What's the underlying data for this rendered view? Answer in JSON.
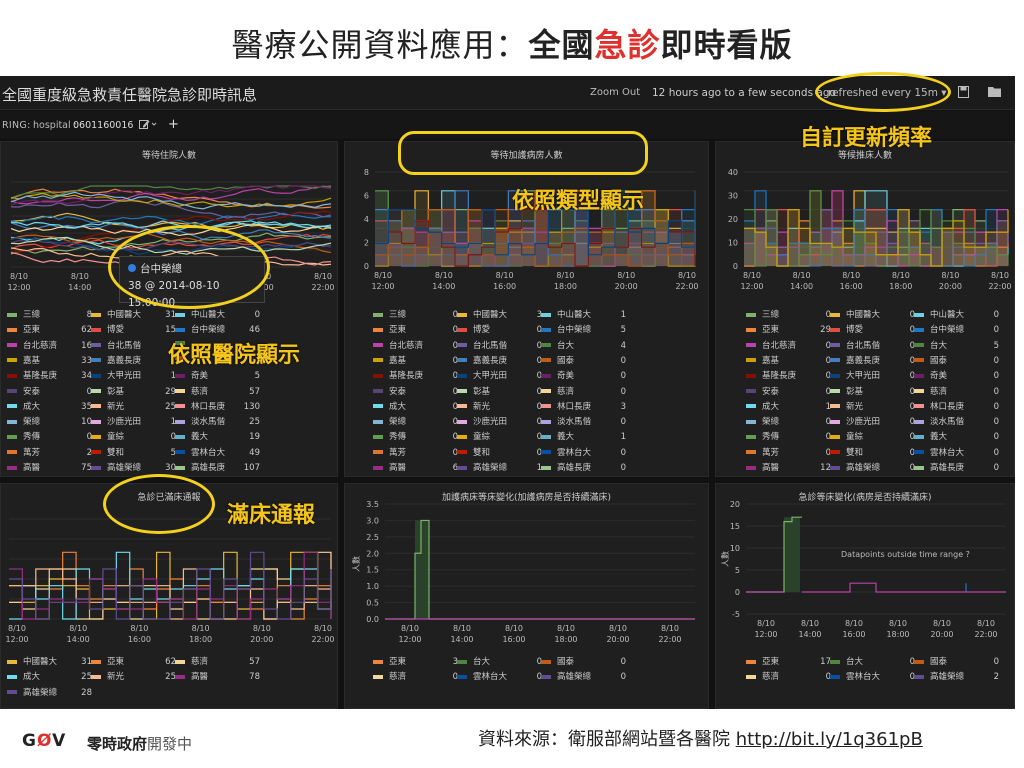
{
  "slide": {
    "title_prefix": "醫療公開資料應用：",
    "title_bold1": "全國",
    "title_red": "急診",
    "title_bold2": "即時看版"
  },
  "dashboard": {
    "title": "全國重度級急救責任醫院急診即時訊息",
    "zoom_out": "Zoom Out",
    "time_range": "12 hours ago to a few seconds ago",
    "refresh": "refreshed every 15m ▾",
    "save_icon": "save-icon",
    "folder_icon": "folder-icon",
    "template_var_label": "RING:",
    "template_var_name": "hospital :",
    "template_var_value": "0601160016",
    "edit_icon": "edit-icon",
    "add_icon": "+"
  },
  "x_ticks_short": [
    "8/10",
    "8/10",
    "8/10",
    "8/10",
    "8/10",
    "8/10"
  ],
  "x_ticks_times": [
    "12:00",
    "14:00",
    "16:00",
    "18:00",
    "20:00",
    "22:00"
  ],
  "panels": {
    "p1": {
      "title": "等待住院人數",
      "tooltip_name": "台中榮總",
      "tooltip_value": "38 @ 2014-08-10 15:00:00",
      "legend": [
        {
          "n": "三總",
          "v": "8",
          "c": "#7eb26d"
        },
        {
          "n": "中國醫大",
          "v": "31",
          "c": "#eab839"
        },
        {
          "n": "中山醫大",
          "v": "0",
          "c": "#6ed0e0"
        },
        {
          "n": "亞東",
          "v": "62",
          "c": "#ef843c"
        },
        {
          "n": "博愛",
          "v": "15",
          "c": "#e24d42"
        },
        {
          "n": "台中榮總",
          "v": "46",
          "c": "#1f78c1"
        },
        {
          "n": "台北慈濟",
          "v": "16",
          "c": "#ba43a9"
        },
        {
          "n": "台北馬偕",
          "v": "",
          "c": "#705da0"
        },
        {
          "n": "",
          "v": "",
          "c": "#508642"
        },
        {
          "n": "嘉基",
          "v": "33",
          "c": "#cca300"
        },
        {
          "n": "嘉義長庚",
          "v": "",
          "c": "#447ebc"
        },
        {
          "n": "",
          "v": "",
          "c": "#c15c17"
        },
        {
          "n": "基隆長庚",
          "v": "34",
          "c": "#890f02"
        },
        {
          "n": "大甲光田",
          "v": "1",
          "c": "#0a437c"
        },
        {
          "n": "奇美",
          "v": "5",
          "c": "#6d1f62"
        },
        {
          "n": "安泰",
          "v": "0",
          "c": "#584477"
        },
        {
          "n": "彰基",
          "v": "29",
          "c": "#b7dbab"
        },
        {
          "n": "慈濟",
          "v": "57",
          "c": "#f4d598"
        },
        {
          "n": "成大",
          "v": "35",
          "c": "#70dbed"
        },
        {
          "n": "新光",
          "v": "25",
          "c": "#f9ba8f"
        },
        {
          "n": "林口長庚",
          "v": "130",
          "c": "#f29191"
        },
        {
          "n": "榮總",
          "v": "10",
          "c": "#82b5d8"
        },
        {
          "n": "沙鹿光田",
          "v": "1",
          "c": "#e5a8e2"
        },
        {
          "n": "淡水馬偕",
          "v": "25",
          "c": "#aea2e0"
        },
        {
          "n": "秀傳",
          "v": "0",
          "c": "#629e51"
        },
        {
          "n": "童綜",
          "v": "0",
          "c": "#e5ac0e"
        },
        {
          "n": "義大",
          "v": "19",
          "c": "#64b0c8"
        },
        {
          "n": "萬芳",
          "v": "2",
          "c": "#e0752d"
        },
        {
          "n": "雙和",
          "v": "5",
          "c": "#bf1b00"
        },
        {
          "n": "雲林台大",
          "v": "49",
          "c": "#0a50a1"
        },
        {
          "n": "高醫",
          "v": "75",
          "c": "#962d82"
        },
        {
          "n": "高雄榮總",
          "v": "30",
          "c": "#614d93"
        },
        {
          "n": "高雄長庚",
          "v": "107",
          "c": "#9ac48a"
        }
      ]
    },
    "p2": {
      "title": "等待加護病房人數",
      "y_ticks": [
        "0",
        "2",
        "4",
        "6",
        "8"
      ],
      "legend": [
        {
          "n": "三總",
          "v": "0",
          "c": "#7eb26d"
        },
        {
          "n": "中國醫大",
          "v": "3",
          "c": "#eab839"
        },
        {
          "n": "中山醫大",
          "v": "1",
          "c": "#6ed0e0"
        },
        {
          "n": "亞東",
          "v": "0",
          "c": "#ef843c"
        },
        {
          "n": "博愛",
          "v": "0",
          "c": "#e24d42"
        },
        {
          "n": "台中榮總",
          "v": "5",
          "c": "#1f78c1"
        },
        {
          "n": "台北慈濟",
          "v": "0",
          "c": "#ba43a9"
        },
        {
          "n": "台北馬偕",
          "v": "0",
          "c": "#705da0"
        },
        {
          "n": "台大",
          "v": "4",
          "c": "#508642"
        },
        {
          "n": "嘉基",
          "v": "0",
          "c": "#cca300"
        },
        {
          "n": "嘉義長庚",
          "v": "0",
          "c": "#447ebc"
        },
        {
          "n": "國泰",
          "v": "0",
          "c": "#c15c17"
        },
        {
          "n": "基隆長庚",
          "v": "0",
          "c": "#890f02"
        },
        {
          "n": "大甲光田",
          "v": "0",
          "c": "#0a437c"
        },
        {
          "n": "奇美",
          "v": "0",
          "c": "#6d1f62"
        },
        {
          "n": "安泰",
          "v": "0",
          "c": "#584477"
        },
        {
          "n": "彰基",
          "v": "0",
          "c": "#b7dbab"
        },
        {
          "n": "慈濟",
          "v": "0",
          "c": "#f4d598"
        },
        {
          "n": "成大",
          "v": "0",
          "c": "#70dbed"
        },
        {
          "n": "新光",
          "v": "0",
          "c": "#f9ba8f"
        },
        {
          "n": "林口長庚",
          "v": "3",
          "c": "#f29191"
        },
        {
          "n": "榮總",
          "v": "0",
          "c": "#82b5d8"
        },
        {
          "n": "沙鹿光田",
          "v": "0",
          "c": "#e5a8e2"
        },
        {
          "n": "淡水馬偕",
          "v": "0",
          "c": "#aea2e0"
        },
        {
          "n": "秀傳",
          "v": "0",
          "c": "#629e51"
        },
        {
          "n": "童綜",
          "v": "0",
          "c": "#e5ac0e"
        },
        {
          "n": "義大",
          "v": "1",
          "c": "#64b0c8"
        },
        {
          "n": "萬芳",
          "v": "0",
          "c": "#e0752d"
        },
        {
          "n": "雙和",
          "v": "0",
          "c": "#bf1b00"
        },
        {
          "n": "雲林台大",
          "v": "0",
          "c": "#0a50a1"
        },
        {
          "n": "高醫",
          "v": "6",
          "c": "#962d82"
        },
        {
          "n": "高雄榮總",
          "v": "1",
          "c": "#614d93"
        },
        {
          "n": "高雄長庚",
          "v": "0",
          "c": "#9ac48a"
        }
      ]
    },
    "p3": {
      "title": "等候推床人數",
      "y_ticks": [
        "0",
        "10",
        "20",
        "30",
        "40"
      ],
      "legend": [
        {
          "n": "三總",
          "v": "0",
          "c": "#7eb26d"
        },
        {
          "n": "中國醫大",
          "v": "0",
          "c": "#eab839"
        },
        {
          "n": "中山醫大",
          "v": "0",
          "c": "#6ed0e0"
        },
        {
          "n": "亞東",
          "v": "29",
          "c": "#ef843c"
        },
        {
          "n": "博愛",
          "v": "0",
          "c": "#e24d42"
        },
        {
          "n": "台中榮總",
          "v": "0",
          "c": "#1f78c1"
        },
        {
          "n": "台北慈濟",
          "v": "0",
          "c": "#ba43a9"
        },
        {
          "n": "台北馬偕",
          "v": "0",
          "c": "#705da0"
        },
        {
          "n": "台大",
          "v": "5",
          "c": "#508642"
        },
        {
          "n": "嘉基",
          "v": "0",
          "c": "#cca300"
        },
        {
          "n": "嘉義長庚",
          "v": "0",
          "c": "#447ebc"
        },
        {
          "n": "國泰",
          "v": "0",
          "c": "#c15c17"
        },
        {
          "n": "基隆長庚",
          "v": "0",
          "c": "#890f02"
        },
        {
          "n": "大甲光田",
          "v": "0",
          "c": "#0a437c"
        },
        {
          "n": "奇美",
          "v": "0",
          "c": "#6d1f62"
        },
        {
          "n": "安泰",
          "v": "0",
          "c": "#584477"
        },
        {
          "n": "彰基",
          "v": "0",
          "c": "#b7dbab"
        },
        {
          "n": "慈濟",
          "v": "0",
          "c": "#f4d598"
        },
        {
          "n": "成大",
          "v": "1",
          "c": "#70dbed"
        },
        {
          "n": "新光",
          "v": "0",
          "c": "#f9ba8f"
        },
        {
          "n": "林口長庚",
          "v": "0",
          "c": "#f29191"
        },
        {
          "n": "榮總",
          "v": "0",
          "c": "#82b5d8"
        },
        {
          "n": "沙鹿光田",
          "v": "0",
          "c": "#e5a8e2"
        },
        {
          "n": "淡水馬偕",
          "v": "0",
          "c": "#aea2e0"
        },
        {
          "n": "秀傳",
          "v": "0",
          "c": "#629e51"
        },
        {
          "n": "童綜",
          "v": "0",
          "c": "#e5ac0e"
        },
        {
          "n": "義大",
          "v": "0",
          "c": "#64b0c8"
        },
        {
          "n": "萬芳",
          "v": "0",
          "c": "#e0752d"
        },
        {
          "n": "雙和",
          "v": "0",
          "c": "#bf1b00"
        },
        {
          "n": "雲林台大",
          "v": "0",
          "c": "#0a50a1"
        },
        {
          "n": "高醫",
          "v": "12",
          "c": "#962d82"
        },
        {
          "n": "高雄榮總",
          "v": "0",
          "c": "#614d93"
        },
        {
          "n": "高雄長庚",
          "v": "0",
          "c": "#9ac48a"
        }
      ]
    },
    "p4": {
      "title": "急診已滿床通報",
      "legend": [
        {
          "n": "中國醫大",
          "v": "31",
          "c": "#eab839"
        },
        {
          "n": "亞東",
          "v": "62",
          "c": "#ef843c"
        },
        {
          "n": "慈濟",
          "v": "57",
          "c": "#f4d598"
        },
        {
          "n": "成大",
          "v": "25",
          "c": "#70dbed"
        },
        {
          "n": "新光",
          "v": "25",
          "c": "#f9ba8f"
        },
        {
          "n": "高醫",
          "v": "78",
          "c": "#962d82"
        },
        {
          "n": "高雄榮總",
          "v": "28",
          "c": "#614d93"
        }
      ]
    },
    "p5": {
      "title": "加護病床等床變化(加護病房是否持續滿床)",
      "y_axis_label": "人數",
      "y_ticks": [
        "0.0",
        "0.5",
        "1.0",
        "1.5",
        "2.0",
        "2.5",
        "3.0",
        "3.5"
      ],
      "legend": [
        {
          "n": "亞東",
          "v": "3",
          "c": "#ef843c"
        },
        {
          "n": "台大",
          "v": "0",
          "c": "#508642"
        },
        {
          "n": "國泰",
          "v": "0",
          "c": "#c15c17"
        },
        {
          "n": "慈濟",
          "v": "0",
          "c": "#f4d598"
        },
        {
          "n": "雲林台大",
          "v": "0",
          "c": "#0a50a1"
        },
        {
          "n": "高雄榮總",
          "v": "0",
          "c": "#614d93"
        }
      ]
    },
    "p6": {
      "title": "急診等床變化(病房是否持續滿床)",
      "y_axis_label": "人數",
      "y_ticks": [
        "-5",
        "0",
        "5",
        "10",
        "15",
        "20"
      ],
      "note": "Datapoints outside time range",
      "legend": [
        {
          "n": "亞東",
          "v": "17",
          "c": "#ef843c"
        },
        {
          "n": "台大",
          "v": "0",
          "c": "#508642"
        },
        {
          "n": "國泰",
          "v": "0",
          "c": "#c15c17"
        },
        {
          "n": "慈濟",
          "v": "0",
          "c": "#f4d598"
        },
        {
          "n": "雲林台大",
          "v": "0",
          "c": "#0a50a1"
        },
        {
          "n": "高雄榮總",
          "v": "2",
          "c": "#614d93"
        }
      ]
    }
  },
  "annotations": {
    "custom_refresh": "自訂更新頻率",
    "by_type": "依照類型顯示",
    "by_hospital": "依照醫院顯示",
    "full_bed": "滿床通報"
  },
  "footer": {
    "logo_g": "G",
    "logo_o": "Ø",
    "logo_v": "V",
    "name": "零時政府",
    "dev": "開發中",
    "source_label": "資料來源：衛服部網站暨各醫院 ",
    "source_url": "http://bit.ly/1q361pB"
  }
}
